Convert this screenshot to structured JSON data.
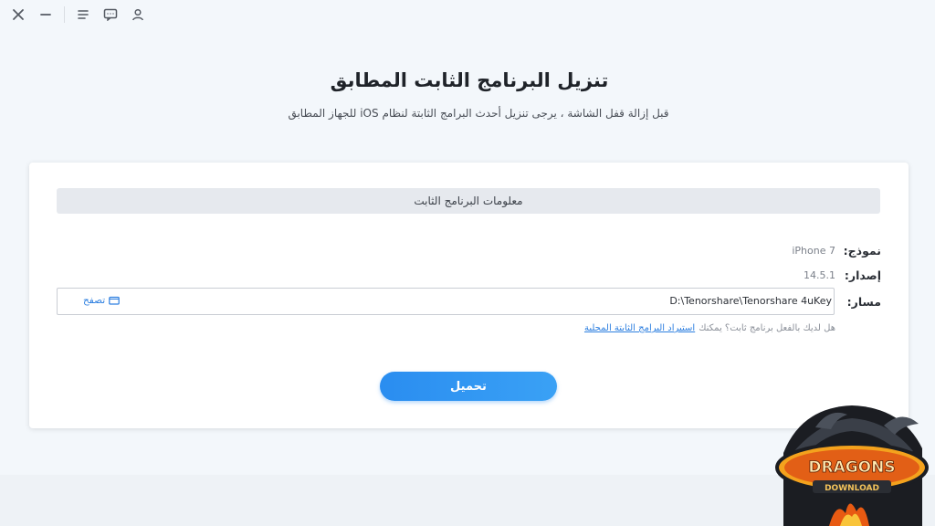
{
  "window": {
    "controls": {
      "close": "close-icon",
      "minimize": "minimize-icon",
      "menu": "menu-icon",
      "feedback": "chat-icon",
      "account": "user-icon"
    }
  },
  "header": {
    "title": "تنزيل البرنامج الثابت المطابق",
    "subtitle": "قبل إزالة قفل الشاشة ، يرجى تنزيل أحدث البرامج الثابتة لنظام iOS للجهاز المطابق"
  },
  "firmware": {
    "section_title": "معلومات البرنامج الثابت",
    "model_label": "نموذج:",
    "model_value": "iPhone 7",
    "version_label": "إصدار:",
    "version_value": "14.5.1",
    "path_label": "مسار:",
    "path_value": "D:\\Tenorshare\\Tenorshare 4uKey",
    "browse_label": "تصفح",
    "hint_text": "هل لديك بالفعل برنامج ثابت؟ يمكنك",
    "hint_link": "استيراد البرامج الثابتة المحلية",
    "download_label": "تحميل"
  },
  "watermark": {
    "brand_text": "DRAGONS DOWNLOAD"
  },
  "colors": {
    "accent": "#2a8df0",
    "background": "#f3f7fb",
    "card": "#ffffff"
  }
}
